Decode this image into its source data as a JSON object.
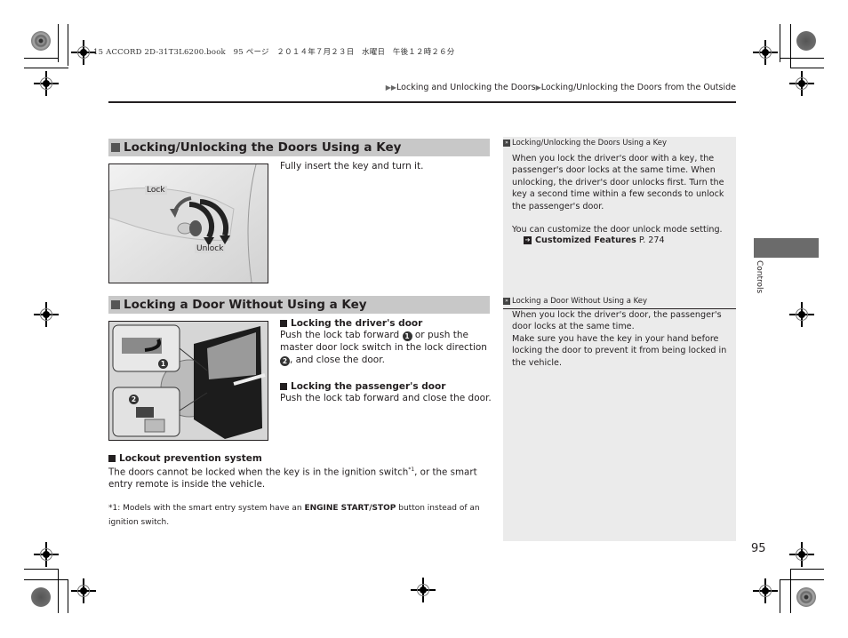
{
  "print_meta": {
    "book_file": "15 ACCORD 2D-31T3L6200.book",
    "page_info": "95 ページ",
    "date": "２０１４年７月２３日　水曜日　午後１２時２６分"
  },
  "breadcrumb": {
    "prefix": "▶▶",
    "items": [
      "Locking and Unlocking the Doors",
      "Locking/Unlocking the Doors from the Outside"
    ],
    "separator": "▶"
  },
  "sections": [
    {
      "title": "Locking/Unlocking the Doors Using a Key",
      "text": "Fully insert the key and turn it.",
      "figure": {
        "labels": [
          "Lock",
          "Unlock"
        ]
      }
    },
    {
      "title": "Locking a Door Without Using a Key",
      "subsections": [
        {
          "heading": "Locking the driver's door",
          "text_part1": "Push the lock tab forward",
          "badge1": "1",
          "text_part2": "or push the master door lock switch in the lock direction",
          "badge2": "2",
          "text_part3": ", and close the door."
        },
        {
          "heading": "Locking the passenger's door",
          "text": "Push the lock tab forward and close the door."
        }
      ],
      "figure": {
        "callouts": [
          "1",
          "2"
        ]
      }
    }
  ],
  "lockout": {
    "heading": "Lockout prevention system",
    "text_part1": "The doors cannot be locked when the key is in the ignition switch",
    "footnote_ref": "*1",
    "text_part2": ", or the smart entry remote is inside the vehicle.",
    "footnote_prefix": "*1: Models with the smart entry system have an",
    "footnote_bold": "ENGINE START/STOP",
    "footnote_suffix": "button instead of an ignition switch."
  },
  "side_notes": [
    {
      "title": "Locking/Unlocking the Doors Using a Key",
      "paragraphs": [
        "When you lock the driver's door with a key, the passenger's door locks at the same time. When unlocking, the driver's door unlocks first. Turn the key a second time within a few seconds to unlock the passenger's door.",
        "You can customize the door unlock mode setting."
      ],
      "xref": {
        "label": "Customized Features",
        "page": "P. 274"
      }
    },
    {
      "title": "Locking a Door Without Using a Key",
      "paragraphs": [
        "When you lock the driver's door, the passenger's door locks at the same time.",
        "Make sure you have the key in your hand before locking the door to prevent it from being locked in the vehicle."
      ]
    }
  ],
  "chapter_tab": "Controls",
  "page_number": "95"
}
